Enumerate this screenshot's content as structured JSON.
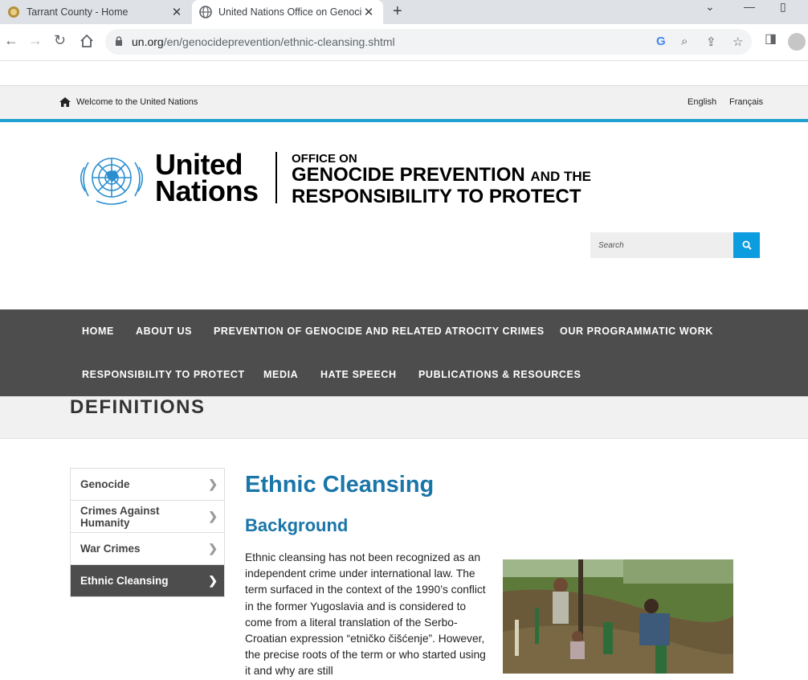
{
  "browser": {
    "tabs": [
      {
        "title": "Tarrant County - Home"
      },
      {
        "title": "United Nations Office on Genocide Prevention"
      }
    ],
    "url_host": "un.org",
    "url_path": "/en/genocideprevention/ethnic-cleansing.shtml"
  },
  "utility": {
    "welcome": "Welcome to the United Nations",
    "lang_en": "English",
    "lang_fr": "Français"
  },
  "logo": {
    "line1": "United",
    "line2": "Nations",
    "office_l1": "OFFICE ON",
    "office_l2": "GENOCIDE PREVENTION",
    "office_l2_small": "AND THE",
    "office_l3": "RESPONSIBILITY TO PROTECT"
  },
  "search": {
    "placeholder": "Search"
  },
  "nav": {
    "items": [
      "HOME",
      "ABOUT US",
      "PREVENTION OF GENOCIDE AND RELATED ATROCITY CRIMES",
      "OUR PROGRAMMATIC WORK",
      "RESPONSIBILITY TO PROTECT",
      "MEDIA",
      "HATE SPEECH",
      "PUBLICATIONS & RESOURCES"
    ]
  },
  "section_title": "DEFINITIONS",
  "sidenav": {
    "items": [
      "Genocide",
      "Crimes Against Humanity",
      "War Crimes",
      "Ethnic Cleansing"
    ],
    "active": "Ethnic Cleansing"
  },
  "content": {
    "title": "Ethnic Cleansing",
    "subtitle": "Background",
    "paragraph": "Ethnic cleansing has not been recognized as an independent crime under international law. The term surfaced in the context of the 1990’s conflict in the former Yugoslavia and is considered to come from a literal translation of the Serbo-Croatian expression “etničko čišćenje”. However, the precise roots of the term or who started using it and why are still"
  },
  "colors": {
    "accent": "#1ea0d2",
    "nav_bg": "#4d4d4d",
    "heading": "#1a75a8",
    "search_button": "#0c9ce0"
  }
}
